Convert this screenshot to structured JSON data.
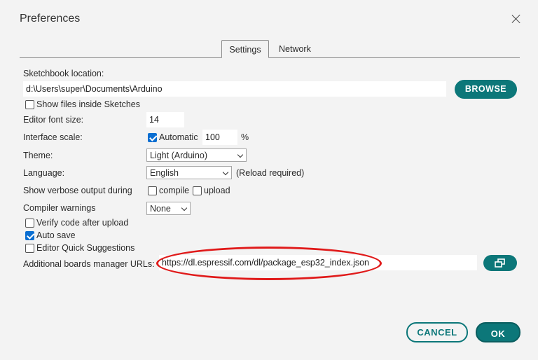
{
  "dialog": {
    "title": "Preferences"
  },
  "tabs": [
    {
      "label": "Settings",
      "active": true
    },
    {
      "label": "Network",
      "active": false
    }
  ],
  "sketchbook": {
    "label": "Sketchbook location:",
    "value": "d:\\Users\\super\\Documents\\Arduino",
    "browse_label": "BROWSE",
    "show_files_label": "Show files inside Sketches",
    "show_files_checked": false
  },
  "editor_font": {
    "label": "Editor font size:",
    "value": "14"
  },
  "interface_scale": {
    "label": "Interface scale:",
    "automatic_label": "Automatic",
    "automatic_checked": true,
    "value": "100",
    "unit": "%"
  },
  "theme": {
    "label": "Theme:",
    "selected": "Light (Arduino)"
  },
  "language": {
    "label": "Language:",
    "selected": "English",
    "note": "(Reload required)"
  },
  "verbose": {
    "label": "Show verbose output during",
    "compile_label": "compile",
    "compile_checked": false,
    "upload_label": "upload",
    "upload_checked": false
  },
  "compiler_warnings": {
    "label": "Compiler warnings",
    "selected": "None"
  },
  "options": [
    {
      "label": "Verify code after upload",
      "checked": false
    },
    {
      "label": "Auto save",
      "checked": true
    },
    {
      "label": "Editor Quick Suggestions",
      "checked": false
    }
  ],
  "boards_urls": {
    "label": "Additional boards manager URLs:",
    "value": "https://dl.espressif.com/dl/package_esp32_index.json"
  },
  "footer": {
    "cancel_label": "CANCEL",
    "ok_label": "OK"
  },
  "colors": {
    "accent": "#0c7779",
    "checkbox": "#0a6ed1",
    "annotation": "#e01a1a"
  }
}
